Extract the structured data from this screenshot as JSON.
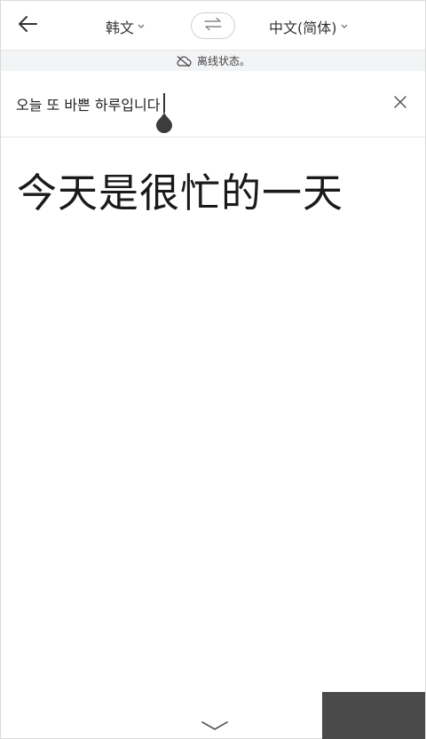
{
  "header": {
    "source_language": "韩文",
    "target_language": "中文(简体)"
  },
  "offline_banner": {
    "text": "离线状态。"
  },
  "input": {
    "source_text": "오늘 또 바쁜 하루입니다"
  },
  "translation": {
    "text": "今天是很忙的一天"
  },
  "icons": {
    "back": "back-arrow-icon",
    "swap": "swap-arrows-icon",
    "offline": "cloud-off-icon",
    "clear": "close-icon",
    "collapse": "chevron-down-icon"
  },
  "colors": {
    "background": "#ffffff",
    "banner_background": "#f3f4f6",
    "text": "#222222",
    "cursor_handle": "#3c3c3c"
  }
}
